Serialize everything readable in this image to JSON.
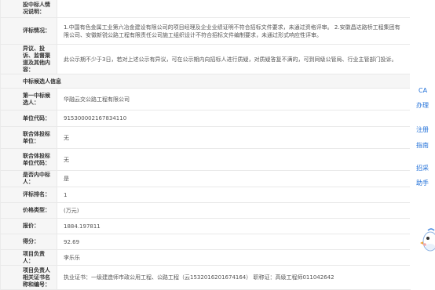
{
  "rows": {
    "r0": {
      "label": "投中标人情况说明："
    },
    "r1": {
      "label": "评标情况：",
      "value": "1.中国有色金属工业第六冶金建设有限公司的项目经理及企业业绩证明不符合招标文件要求，未通过资格评审。 2.安徽昌达路桥工程集团有限公司、安徽新锐公路工程有限责任公司施工组织设计不符合招标文件编制要求，未通过形式响应性评审。"
    },
    "r2": {
      "label": "异议、投诉、监督渠道及其他内容：",
      "value": "此公示期不少于3日，若对上述公示有异议，可在公示期内向招标人进行质疑，对质疑答复不满的，可到同级公管局、行业主管部门投诉。"
    },
    "section": "中标候选人信息",
    "r3": {
      "label": "第一中标候选人：",
      "value": "华融云交公路工程有限公司"
    },
    "r4": {
      "label": "单位代码：",
      "value": "915300002167834110"
    },
    "r5": {
      "label": "联合体投标单位：",
      "value": "无"
    },
    "r6": {
      "label": "联合体投标单位代码：",
      "value": "无"
    },
    "r7": {
      "label": "是否内中标人：",
      "value": "是"
    },
    "r8": {
      "label": "评标排名：",
      "value": "1"
    },
    "r9": {
      "label": "价格类型：",
      "value": "(万元)"
    },
    "r10": {
      "label": "报价：",
      "value": "1884.197811"
    },
    "r11": {
      "label": "得分：",
      "value": "92.69"
    },
    "r12": {
      "label": "项目负责人：",
      "value": "李乐乐"
    },
    "r13": {
      "label": "项目负责人相关证书名称和编号：",
      "value": "执业证书：一级建造师市政公用工程、公路工程（云1532016201674164） 职称证：高级工程师011042642"
    }
  },
  "side_links": [
    "CA",
    "办理",
    "注册",
    "指南",
    "招采",
    "助手"
  ]
}
